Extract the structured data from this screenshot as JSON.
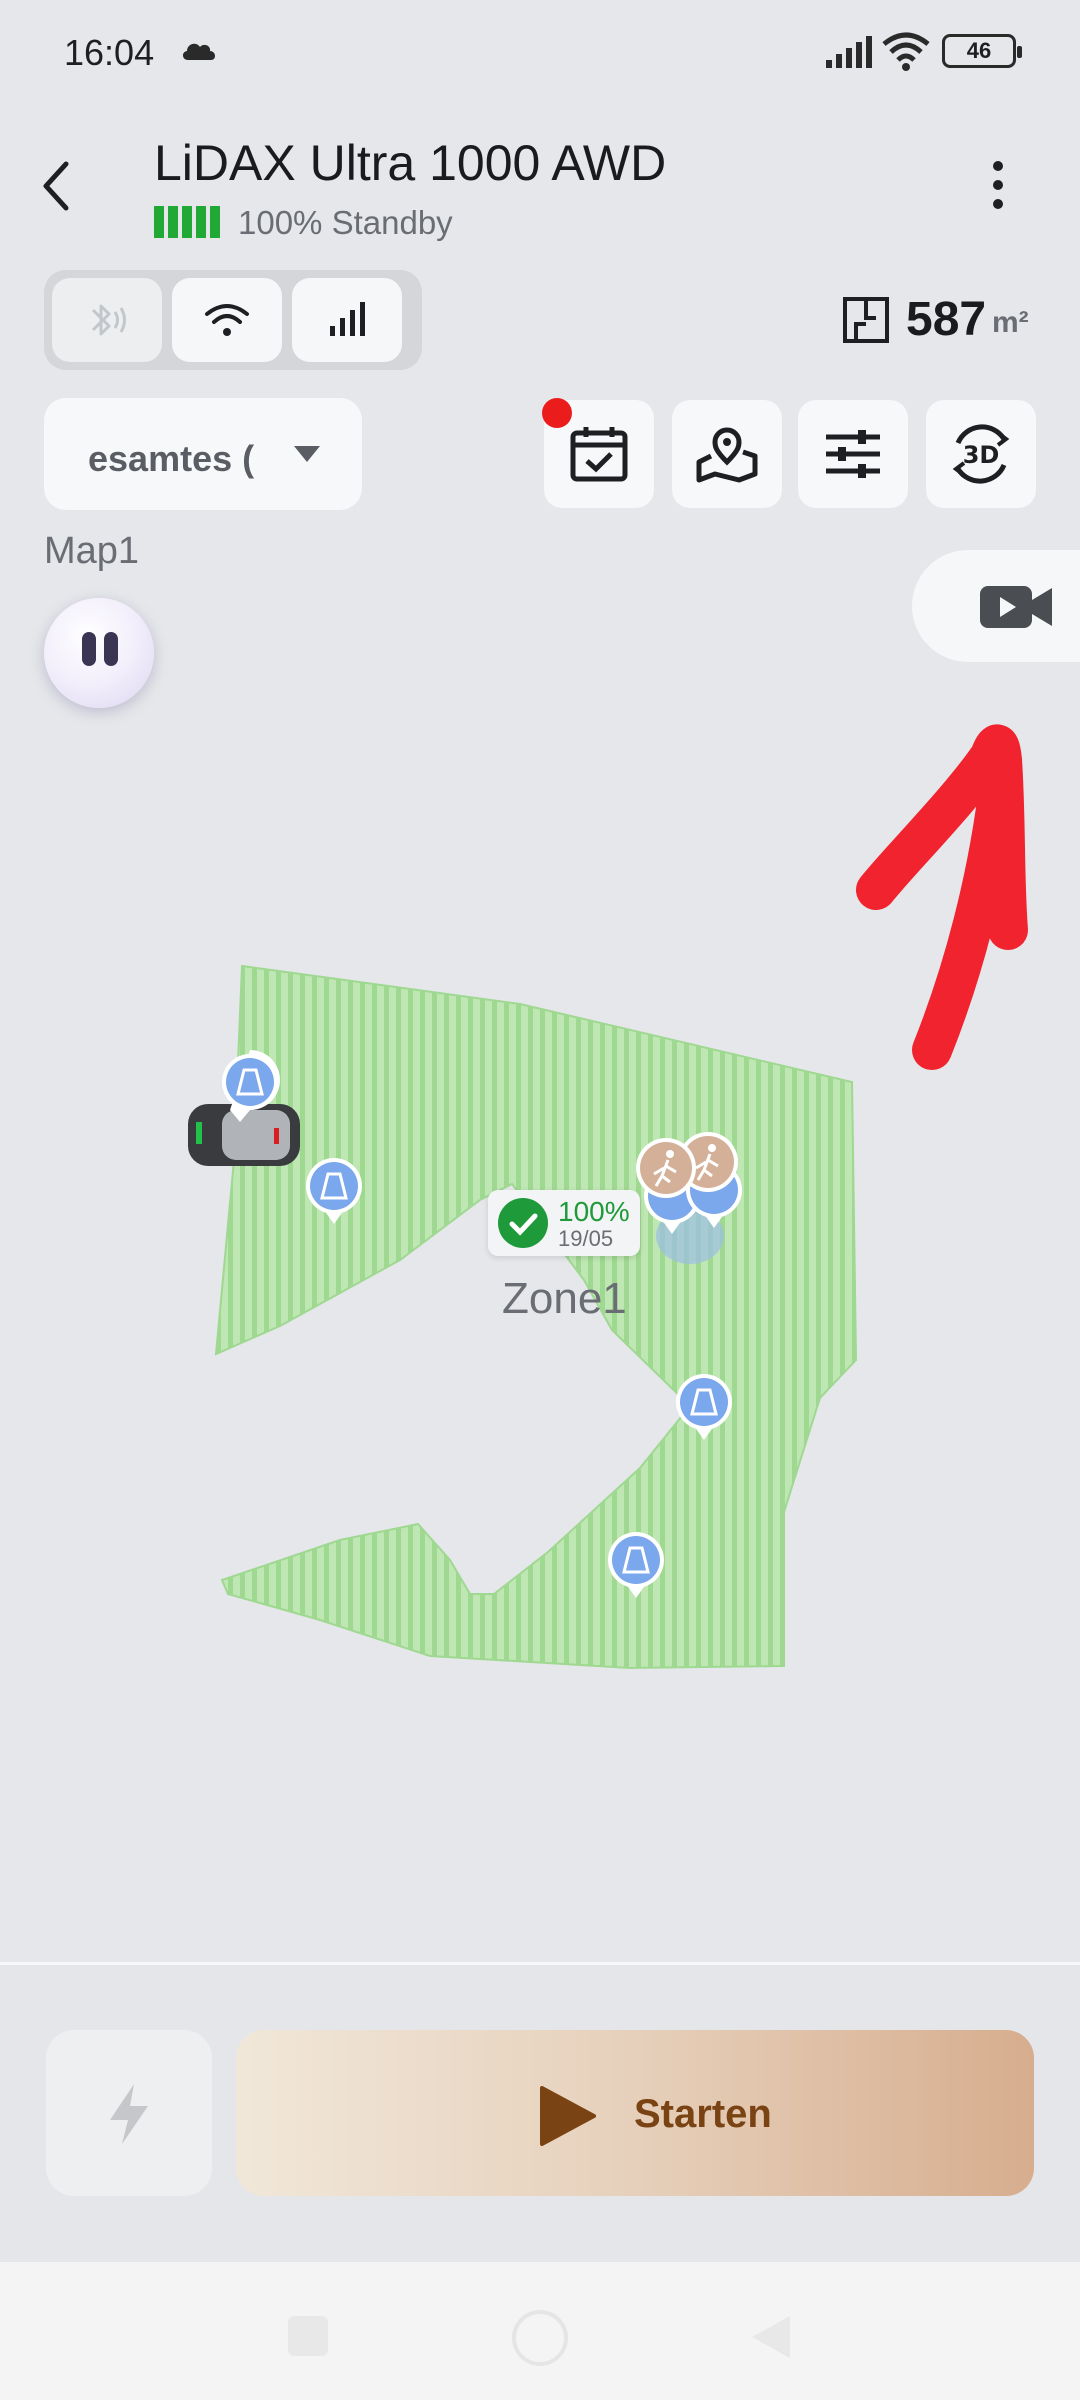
{
  "status_bar": {
    "time": "16:04",
    "battery_level": "46",
    "icons": [
      "cloud-icon",
      "signal-icon",
      "wifi-icon",
      "battery-icon"
    ]
  },
  "header": {
    "title": "LiDAX Ultra 1000 AWD",
    "battery_percent": "100%",
    "status": "Standby",
    "battery_fill": 1.0,
    "battery_color": "#22a834"
  },
  "connectivity": {
    "buttons": [
      "bluetooth-icon",
      "wifi-icon",
      "cellular-icon"
    ]
  },
  "area": {
    "value": "587",
    "unit": "m²"
  },
  "zone_selector": {
    "selected": "esamtes (",
    "icon": "chevron-down-icon"
  },
  "toolbar": {
    "buttons": [
      "schedule-icon",
      "map-pin-icon",
      "settings-sliders-icon",
      "view-3d-icon"
    ],
    "notification_color": "#ea1c1c"
  },
  "map": {
    "name": "Map1",
    "lawn_color": "#a8dc9a",
    "zone_name": "Zone1",
    "zone_progress": "100%",
    "zone_date": "19/05"
  },
  "actions": {
    "start_label": "Starten",
    "start_gradient": [
      "#f1e7d9",
      "#d7ad8e"
    ],
    "start_text_color": "#7a4314"
  }
}
